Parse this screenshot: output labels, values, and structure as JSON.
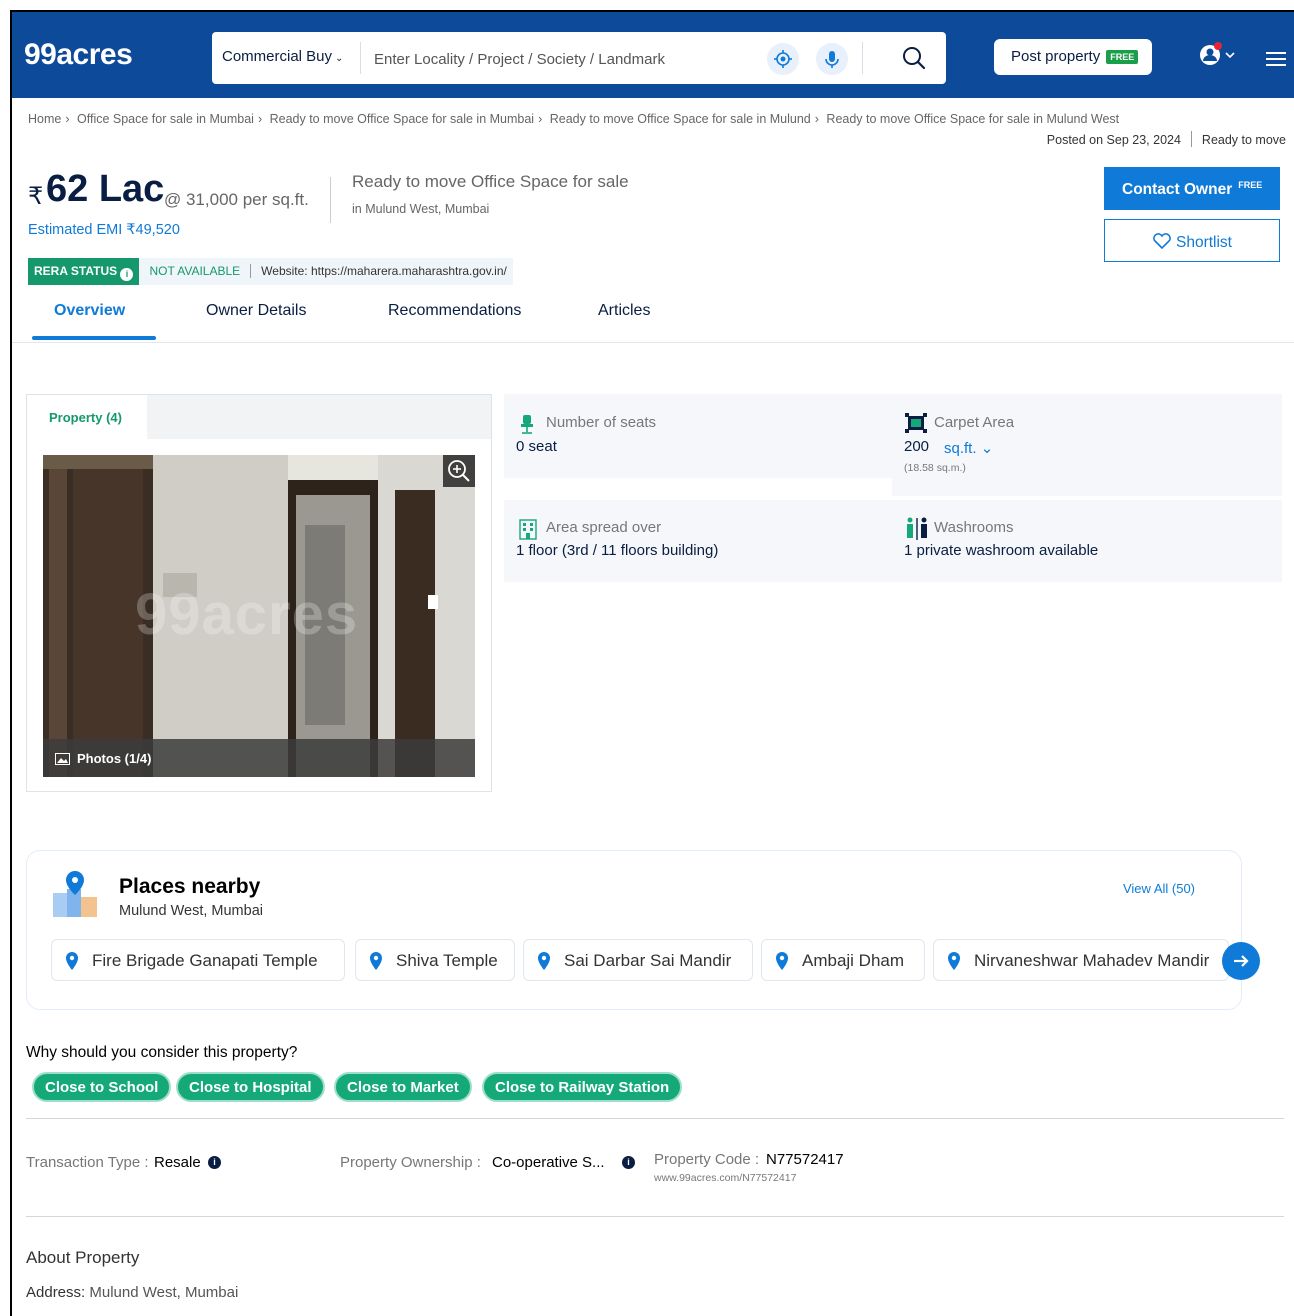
{
  "header": {
    "logo": "99acres",
    "category": "Commercial Buy",
    "search_placeholder": "Enter Locality / Project / Society / Landmark",
    "post_property": "Post property",
    "free_badge": "FREE",
    "brand_color": "#0d4a9a"
  },
  "breadcrumb": [
    "Home",
    "Office Space for sale in Mumbai",
    "Ready to move Office Space for sale in Mumbai",
    "Ready to move Office Space for sale in Mulund",
    "Ready to move Office Space for sale in Mulund West"
  ],
  "posted": {
    "date": "Posted on Sep 23, 2024",
    "status": "Ready to move"
  },
  "listing": {
    "rupee": "₹",
    "price": "62 Lac",
    "per_sqft": "@ 31,000 per sq.ft.",
    "emi": "Estimated EMI ₹49,520",
    "title": "Ready to move Office Space for sale",
    "location": "in Mulund West, Mumbai",
    "contact": "Contact Owner",
    "contact_free": "FREE",
    "shortlist": "Shortlist"
  },
  "rera": {
    "label": "RERA STATUS",
    "status": "NOT AVAILABLE",
    "website": "Website: https://maharera.maharashtra.gov.in/"
  },
  "tabs": [
    "Overview",
    "Owner Details",
    "Recommendations",
    "Articles"
  ],
  "gallery": {
    "tab": "Property (4)",
    "photos": "Photos (1/4)",
    "watermark": "99acres"
  },
  "features": {
    "seats_label": "Number of seats",
    "seats_value": "0 seat",
    "carpet_label": "Carpet Area",
    "carpet_value": "200",
    "carpet_unit": "sq.ft.",
    "carpet_sub": "(18.58 sq.m.)",
    "floor_label": "Area spread over",
    "floor_value": "1 floor (3rd / 11 floors building)",
    "wash_label": "Washrooms",
    "wash_value": "1 private washroom available"
  },
  "places": {
    "title": "Places nearby",
    "subtitle": "Mulund West, Mumbai",
    "view_all": "View All (50)",
    "items": [
      "Fire Brigade Ganapati Temple",
      "Shiva Temple",
      "Sai Darbar Sai Mandir",
      "Ambaji Dham",
      "Nirvaneshwar Mahadev Mandir"
    ]
  },
  "why": {
    "title": "Why should you consider this property?",
    "reasons": [
      "Close to School",
      "Close to Hospital",
      "Close to Market",
      "Close to Railway Station"
    ]
  },
  "details": {
    "transaction_label": "Transaction Type :",
    "transaction_value": "Resale",
    "ownership_label": "Property Ownership :",
    "ownership_value": "Co-operative S...",
    "code_label": "Property Code :",
    "code_value": "N77572417",
    "code_url": "www.99acres.com/N77572417"
  },
  "about": {
    "title": "About Property",
    "address_label": "Address:",
    "address_value": "Mulund West, Mumbai"
  }
}
